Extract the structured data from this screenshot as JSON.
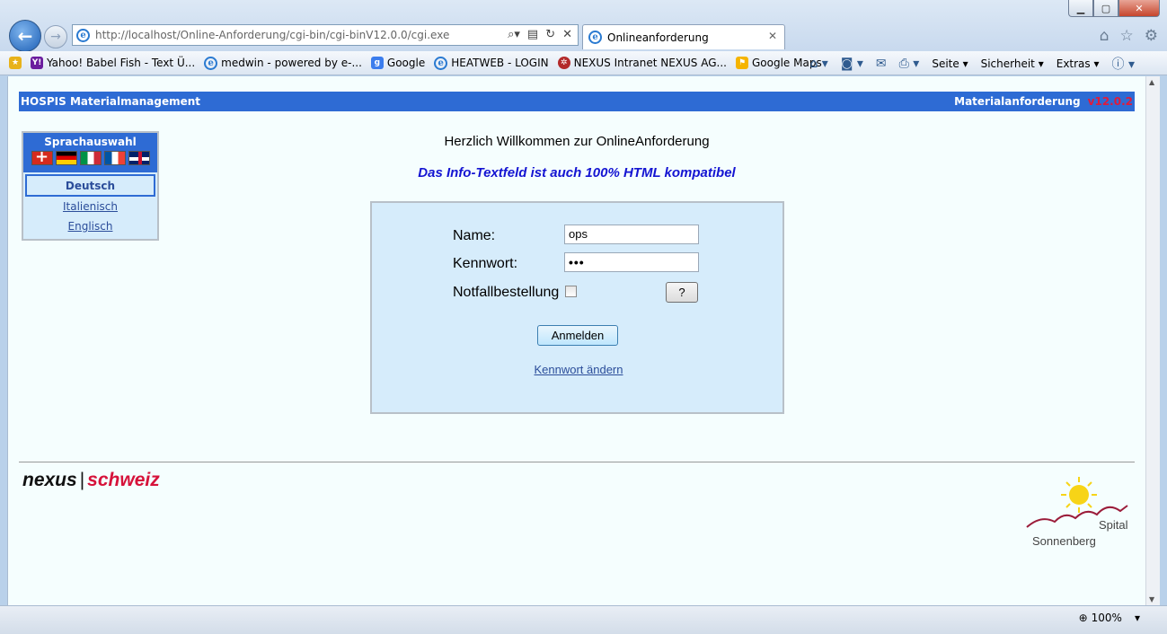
{
  "browser": {
    "url": "http://localhost/Online-Anforderung/cgi-bin/cgi-binV12.0.0/cgi.exe",
    "tab_title": "Onlineanforderung",
    "favorites": [
      "Yahoo! Babel Fish - Text Ü...",
      "medwin - powered by e-...",
      "Google",
      "HEATWEB - LOGIN",
      "NEXUS Intranet NEXUS AG...",
      "Google Maps"
    ],
    "commands": {
      "page": "Seite",
      "security": "Sicherheit",
      "extras": "Extras"
    },
    "zoom": "100%"
  },
  "app": {
    "title": "HOSPIS Materialmanagement",
    "section": "Materialanforderung",
    "version": "v12.0.2"
  },
  "language": {
    "heading": "Sprachauswahl",
    "items": [
      "Deutsch",
      "Italienisch",
      "Englisch"
    ],
    "active": "Deutsch"
  },
  "welcome": "Herzlich Willkommen zur OnlineAnforderung",
  "info": "Das Info-Textfeld ist auch 100% HTML kompatibel",
  "login": {
    "name_label": "Name:",
    "name_value": "ops",
    "password_label": "Kennwort:",
    "password_value": "•••",
    "emergency_label": "Notfallbestellung",
    "help_label": "?",
    "submit_label": "Anmelden",
    "change_password_label": "Kennwort ändern"
  },
  "footer": {
    "logo_left": "nexus",
    "logo_right": "schweiz",
    "spital_line1": "Spital",
    "spital_line2": "Sonnenberg"
  }
}
